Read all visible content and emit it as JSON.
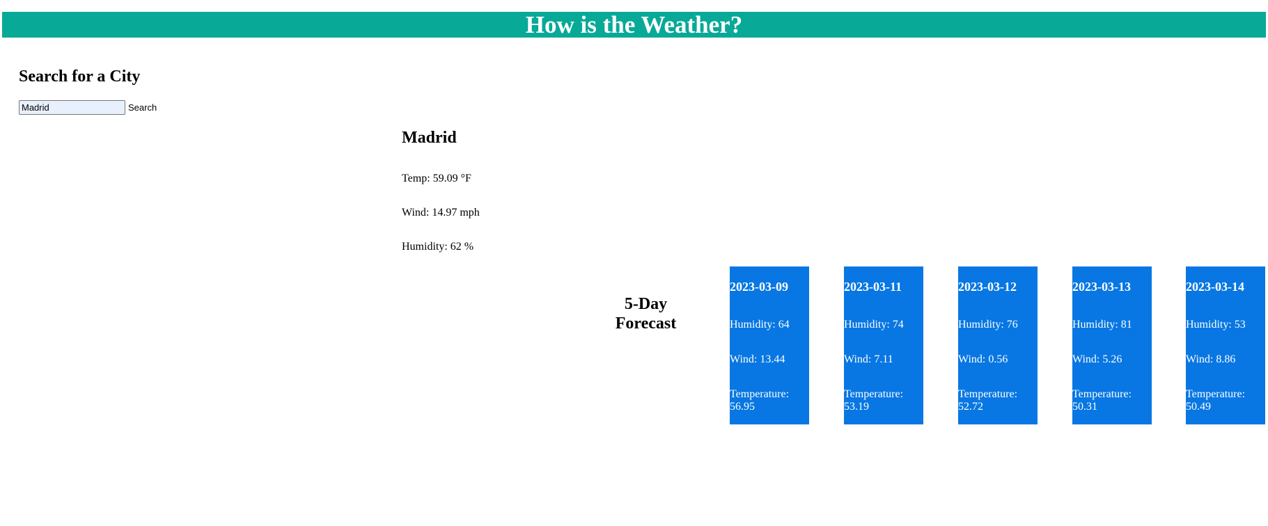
{
  "header": {
    "title": "How is the Weather?"
  },
  "search": {
    "title": "Search for a City",
    "input_value": "Madrid",
    "button_label": "Search"
  },
  "current": {
    "city": "Madrid",
    "temp": "Temp: 59.09 °F",
    "wind": "Wind: 14.97 mph",
    "humidity": "Humidity: 62 %"
  },
  "forecast": {
    "title_line1": "5-Day",
    "title_line2": "Forecast",
    "days": [
      {
        "date": "2023-03-09",
        "humidity": "Humidity: 64",
        "wind": "Wind: 13.44",
        "temperature": "Temperature: 56.95"
      },
      {
        "date": "2023-03-11",
        "humidity": "Humidity: 74",
        "wind": "Wind: 7.11",
        "temperature": "Temperature: 53.19"
      },
      {
        "date": "2023-03-12",
        "humidity": "Humidity: 76",
        "wind": "Wind: 0.56",
        "temperature": "Temperature: 52.72"
      },
      {
        "date": "2023-03-13",
        "humidity": "Humidity: 81",
        "wind": "Wind: 5.26",
        "temperature": "Temperature: 50.31"
      },
      {
        "date": "2023-03-14",
        "humidity": "Humidity: 53",
        "wind": "Wind: 8.86",
        "temperature": "Temperature: 50.49"
      }
    ]
  },
  "colors": {
    "header_bg": "#08a997",
    "card_bg": "#0877e3",
    "input_bg": "#e8f0fe"
  }
}
